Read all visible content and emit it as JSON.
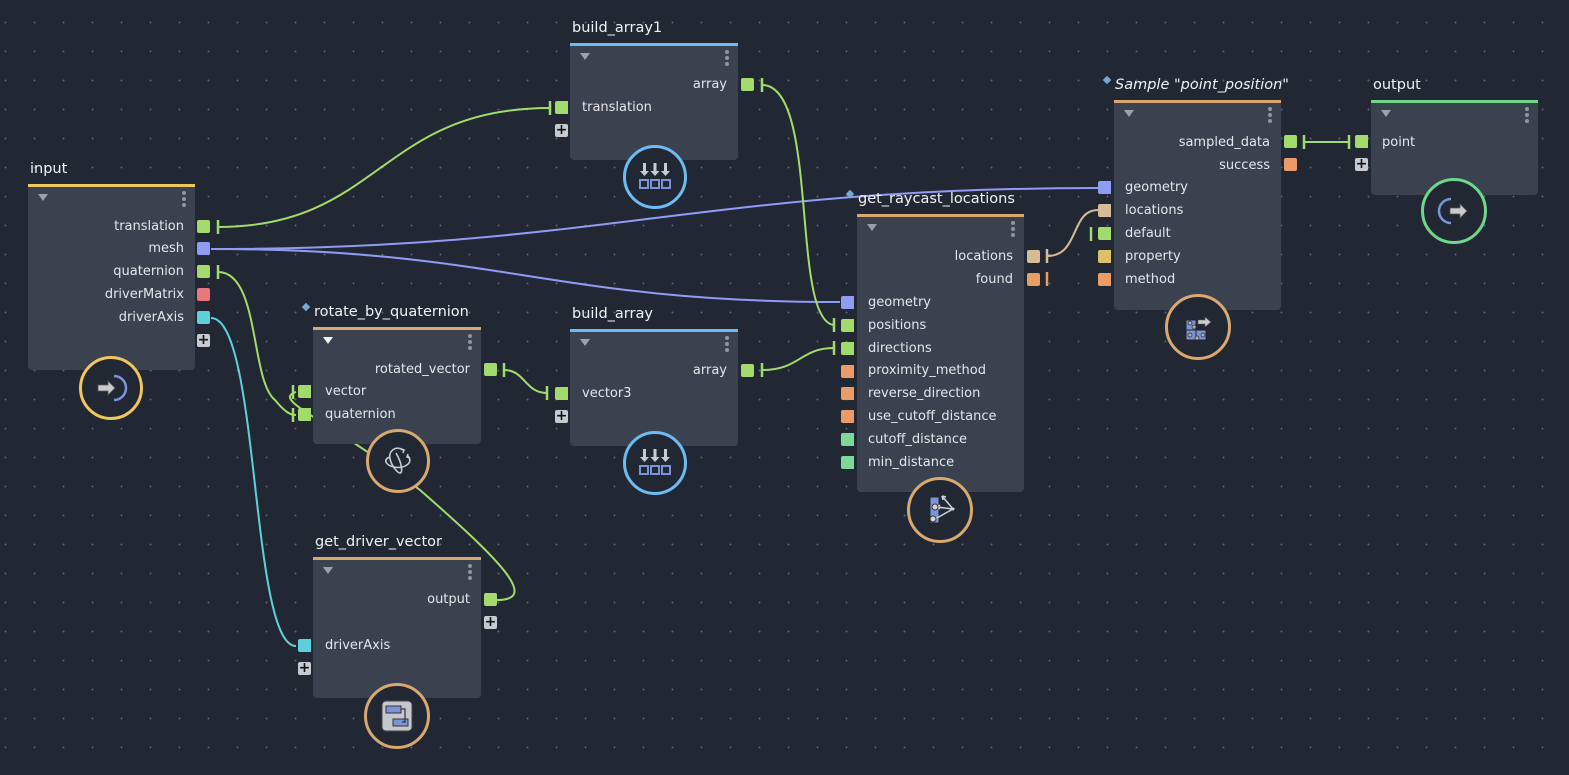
{
  "colors": {
    "vector3": "#a3da6c",
    "mesh": "#8f9cf4",
    "matrix": "#e8767a",
    "axis": "#5ed0dc",
    "string": "#eb9b66",
    "float": "#7dd89a",
    "locations": "#d6bb98",
    "property": "#dfc06a",
    "header_input": "#f2c65e",
    "header_array": "#6cbcf3",
    "header_compound": "#d9a870",
    "header_output": "#6fd68a"
  },
  "nodes": {
    "input": {
      "title": "input",
      "outputs": [
        "translation",
        "mesh",
        "quaternion",
        "driverMatrix",
        "driverAxis"
      ],
      "icon": "input-arrow-icon"
    },
    "build_array1": {
      "title": "build_array1",
      "outputs": [
        "array"
      ],
      "inputs": [
        "translation"
      ],
      "icon": "build-array-icon"
    },
    "rotate_by_quaternion": {
      "title": "rotate_by_quaternion",
      "outputs": [
        "rotated_vector"
      ],
      "inputs": [
        "vector",
        "quaternion"
      ],
      "icon": "rotate-icon"
    },
    "build_array": {
      "title": "build_array",
      "outputs": [
        "array"
      ],
      "inputs": [
        "vector3"
      ],
      "icon": "build-array-icon"
    },
    "get_driver_vector": {
      "title": "get_driver_vector",
      "outputs": [
        "output"
      ],
      "inputs": [
        "driverAxis"
      ],
      "icon": "compound-icon"
    },
    "get_raycast_locations": {
      "title": "get_raycast_locations",
      "outputs": [
        "locations",
        "found"
      ],
      "inputs": [
        "geometry",
        "positions",
        "directions",
        "proximity_method",
        "reverse_direction",
        "use_cutoff_distance",
        "cutoff_distance",
        "min_distance"
      ],
      "icon": "raycast-icon"
    },
    "sample_point_position": {
      "title": "Sample \"point_position\"",
      "outputs": [
        "sampled_data",
        "success"
      ],
      "inputs": [
        "geometry",
        "locations",
        "default",
        "property",
        "method"
      ],
      "icon": "sample-icon"
    },
    "output": {
      "title": "output",
      "inputs": [
        "point"
      ],
      "icon": "output-arrow-icon"
    }
  },
  "connections": [
    {
      "from": "input.translation",
      "to": "build_array1.translation"
    },
    {
      "from": "input.mesh",
      "to": "sample_point_position.geometry"
    },
    {
      "from": "input.mesh",
      "to": "get_raycast_locations.geometry"
    },
    {
      "from": "input.quaternion",
      "to": "rotate_by_quaternion.quaternion"
    },
    {
      "from": "input.driverAxis",
      "to": "get_driver_vector.driverAxis"
    },
    {
      "from": "get_driver_vector.output",
      "to": "rotate_by_quaternion.vector"
    },
    {
      "from": "rotate_by_quaternion.rotated_vector",
      "to": "build_array.vector3"
    },
    {
      "from": "build_array1.array",
      "to": "get_raycast_locations.positions"
    },
    {
      "from": "build_array.array",
      "to": "get_raycast_locations.directions"
    },
    {
      "from": "get_raycast_locations.locations",
      "to": "sample_point_position.locations"
    },
    {
      "from": "sample_point_position.sampled_data",
      "to": "output.point"
    }
  ]
}
